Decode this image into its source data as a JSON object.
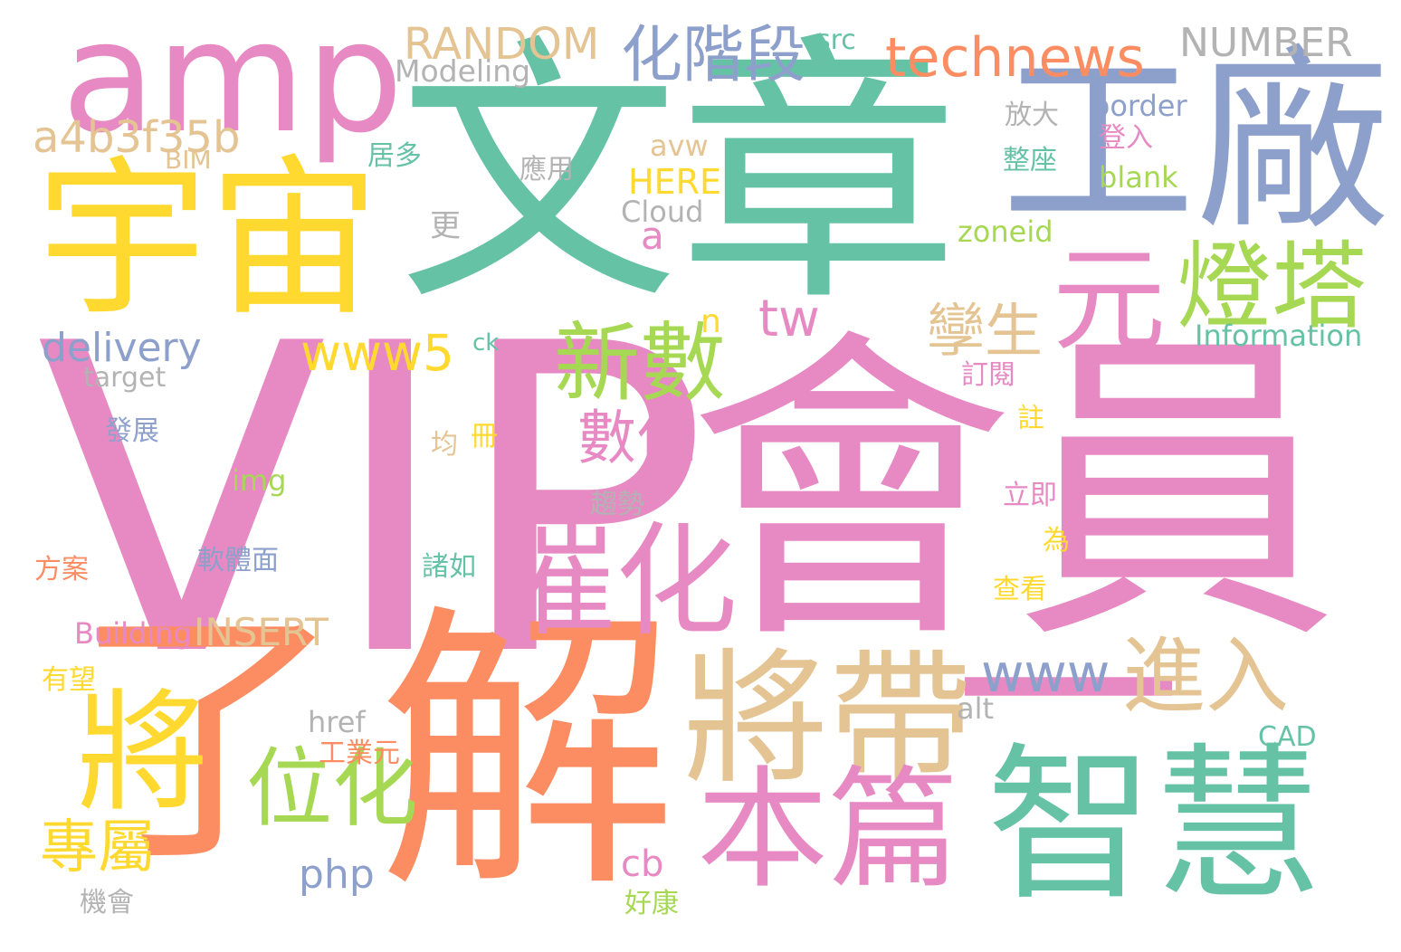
{
  "palette": {
    "green": "#66c2a5",
    "orange": "#fc8d62",
    "blue": "#8da0cb",
    "pink": "#e78ac3",
    "lime": "#a6d854",
    "yellow": "#ffd92f",
    "tan": "#e5c494",
    "gray": "#b3b3b3"
  },
  "words": [
    {
      "id": "vip",
      "text": "VIP",
      "color": "pink"
    },
    {
      "id": "hui-yuan",
      "text": "會員",
      "color": "pink"
    },
    {
      "id": "wen-zhang",
      "text": "文章",
      "color": "green"
    },
    {
      "id": "jie",
      "text": "解",
      "color": "orange"
    },
    {
      "id": "liao",
      "text": "了",
      "color": "orange"
    },
    {
      "id": "yu-zhou",
      "text": "宇宙",
      "color": "yellow"
    },
    {
      "id": "gong-chang",
      "text": "工廠",
      "color": "blue"
    },
    {
      "id": "amp",
      "text": "amp",
      "color": "pink"
    },
    {
      "id": "zhi-hui",
      "text": "智慧",
      "color": "green"
    },
    {
      "id": "yi",
      "text": "一",
      "color": "pink"
    },
    {
      "id": "jiang-dai",
      "text": "將帶",
      "color": "tan"
    },
    {
      "id": "ben-pian",
      "text": "本篇",
      "color": "pink"
    },
    {
      "id": "cui-hua",
      "text": "催化",
      "color": "pink"
    },
    {
      "id": "jiang",
      "text": "將",
      "color": "yellow"
    },
    {
      "id": "yuan",
      "text": "元",
      "color": "pink"
    },
    {
      "id": "deng-ta",
      "text": "燈塔",
      "color": "lime"
    },
    {
      "id": "xin-shu",
      "text": "新數",
      "color": "lime"
    },
    {
      "id": "wei-hua",
      "text": "位化",
      "color": "lime"
    },
    {
      "id": "jin-ru",
      "text": "進入",
      "color": "tan"
    },
    {
      "id": "shu-wei",
      "text": "數位",
      "color": "pink"
    },
    {
      "id": "hua-jie-duan",
      "text": "化階段",
      "color": "blue"
    },
    {
      "id": "technews",
      "text": "technews",
      "color": "orange"
    },
    {
      "id": "luan-sheng",
      "text": "孿生",
      "color": "tan"
    },
    {
      "id": "zhuan-shu",
      "text": "專屬",
      "color": "yellow"
    },
    {
      "id": "www5",
      "text": "www5",
      "color": "yellow"
    },
    {
      "id": "random",
      "text": "RANDOM",
      "color": "tan"
    },
    {
      "id": "number",
      "text": "NUMBER",
      "color": "gray"
    },
    {
      "id": "a4b3f35b",
      "text": "a4b3f35b",
      "color": "tan"
    },
    {
      "id": "delivery",
      "text": "delivery",
      "color": "blue"
    },
    {
      "id": "www",
      "text": "www",
      "color": "blue"
    },
    {
      "id": "tw",
      "text": "tw",
      "color": "pink"
    },
    {
      "id": "insert",
      "text": "INSERT",
      "color": "tan"
    },
    {
      "id": "php",
      "text": "php",
      "color": "blue"
    },
    {
      "id": "cb",
      "text": "cb",
      "color": "pink"
    },
    {
      "id": "a",
      "text": "a",
      "color": "pink"
    },
    {
      "id": "n",
      "text": "n",
      "color": "yellow"
    },
    {
      "id": "here",
      "text": "HERE",
      "color": "yellow"
    },
    {
      "id": "modeling",
      "text": "Modeling",
      "color": "gray"
    },
    {
      "id": "src",
      "text": "src",
      "color": "green"
    },
    {
      "id": "border",
      "text": "border",
      "color": "blue"
    },
    {
      "id": "fang-da",
      "text": "放大",
      "color": "gray"
    },
    {
      "id": "deng-ru",
      "text": "登入",
      "color": "pink"
    },
    {
      "id": "zheng-zuo",
      "text": "整座",
      "color": "green"
    },
    {
      "id": "blank",
      "text": "blank",
      "color": "lime"
    },
    {
      "id": "zoneid",
      "text": "zoneid",
      "color": "lime"
    },
    {
      "id": "information",
      "text": "Information",
      "color": "green"
    },
    {
      "id": "avw",
      "text": "avw",
      "color": "tan"
    },
    {
      "id": "bim",
      "text": "BIM",
      "color": "tan"
    },
    {
      "id": "ju-duo",
      "text": "居多",
      "color": "green"
    },
    {
      "id": "ying-yong",
      "text": "應用",
      "color": "gray"
    },
    {
      "id": "cloud",
      "text": "Cloud",
      "color": "gray"
    },
    {
      "id": "geng",
      "text": "更",
      "color": "gray"
    },
    {
      "id": "target",
      "text": "target",
      "color": "gray"
    },
    {
      "id": "ck",
      "text": "ck",
      "color": "green"
    },
    {
      "id": "ding-yue",
      "text": "訂閱",
      "color": "pink"
    },
    {
      "id": "zhu",
      "text": "註",
      "color": "yellow"
    },
    {
      "id": "fa-zhan",
      "text": "發展",
      "color": "blue"
    },
    {
      "id": "ce",
      "text": "冊",
      "color": "yellow"
    },
    {
      "id": "jun",
      "text": "均",
      "color": "tan"
    },
    {
      "id": "img",
      "text": "img",
      "color": "lime"
    },
    {
      "id": "qu-shi",
      "text": "趨勢",
      "color": "gray"
    },
    {
      "id": "li-ji",
      "text": "立即",
      "color": "pink"
    },
    {
      "id": "wei",
      "text": "為",
      "color": "yellow"
    },
    {
      "id": "fang-an",
      "text": "方案",
      "color": "orange"
    },
    {
      "id": "ruan-ti-mian",
      "text": "軟體面",
      "color": "blue"
    },
    {
      "id": "zhu-ru",
      "text": "諸如",
      "color": "green"
    },
    {
      "id": "cha-kan",
      "text": "查看",
      "color": "yellow"
    },
    {
      "id": "building",
      "text": "Building",
      "color": "pink"
    },
    {
      "id": "you-wang",
      "text": "有望",
      "color": "yellow"
    },
    {
      "id": "href",
      "text": "href",
      "color": "gray"
    },
    {
      "id": "alt",
      "text": "alt",
      "color": "gray"
    },
    {
      "id": "gong-ye-yuan",
      "text": "工業元",
      "color": "orange"
    },
    {
      "id": "cad",
      "text": "CAD",
      "color": "green"
    },
    {
      "id": "ji-hui",
      "text": "機會",
      "color": "gray"
    },
    {
      "id": "hao-kang",
      "text": "好康",
      "color": "lime"
    }
  ]
}
